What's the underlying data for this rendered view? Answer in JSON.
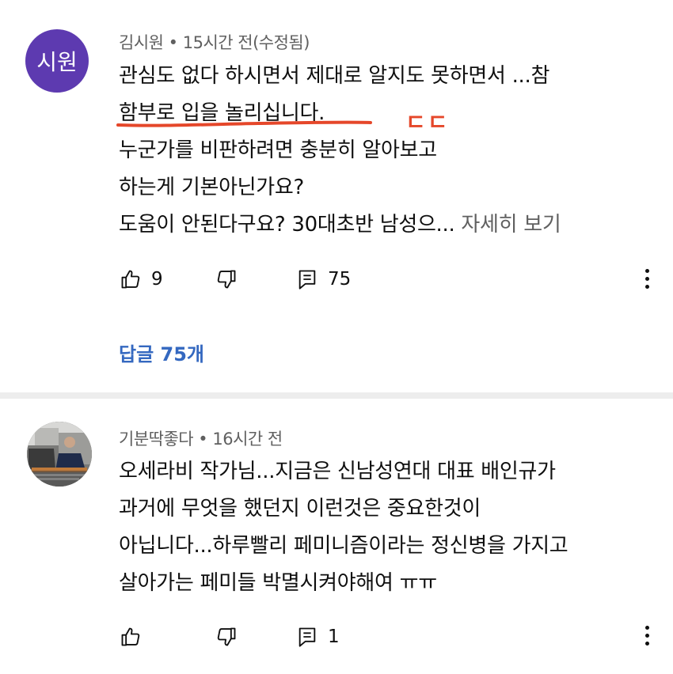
{
  "comments": [
    {
      "avatar_text": "시원",
      "author": "김시원",
      "dot": "•",
      "time": "15시간 전(수정됨)",
      "lines": [
        "관심도 없다 하시면서 제대로 알지도 못하면서 ...참",
        "함부로 입을 놀리십니다.",
        "누군가를 비판하려면 충분히 알아보고",
        "하는게 기본아닌가요?",
        "도움이 안된다구요? 30대초반 남성으..."
      ],
      "more_label": "자세히 보기",
      "likes": "9",
      "reply_count": "75",
      "replies_label": "답글 75개",
      "annotation_text": "ㄷㄷ",
      "annotation_color": "#e5472a"
    },
    {
      "author": "기분딱좋다",
      "dot": "•",
      "time": "16시간 전",
      "lines": [
        "오세라비 작가님...지금은 신남성연대 대표 배인규가",
        "과거에 무엇을 했던지 이런것은 중요한것이",
        "아닙니다...하루빨리 페미니즘이라는 정신병을 가지고",
        "살아가는 페미들 박멸시켜야해여 ㅠㅠ"
      ],
      "likes": "",
      "reply_count": "1"
    }
  ],
  "colors": {
    "link": "#3468c0",
    "meta": "#606060",
    "divider": "#ededed",
    "avatar_bg": "#5d3ab0"
  },
  "icons": [
    "thumbs-up-icon",
    "thumbs-down-icon",
    "reply-icon",
    "more-vert-icon"
  ]
}
